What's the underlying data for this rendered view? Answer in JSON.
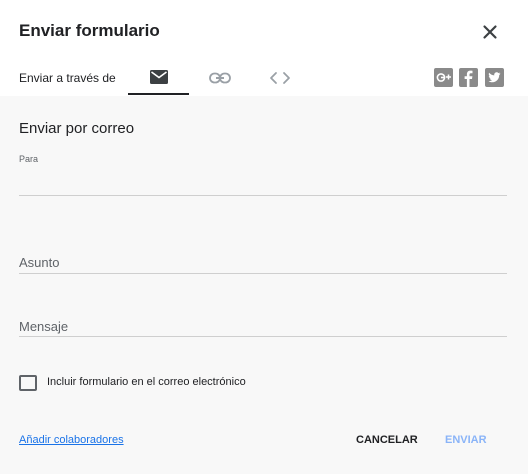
{
  "dialog": {
    "title": "Enviar formulario",
    "close_icon": "close-icon"
  },
  "send_via": {
    "label": "Enviar a través de",
    "tabs": [
      {
        "name": "email",
        "icon": "mail-icon",
        "active": true
      },
      {
        "name": "link",
        "icon": "link-icon",
        "active": false
      },
      {
        "name": "embed",
        "icon": "code-icon",
        "active": false
      }
    ],
    "social": [
      {
        "name": "google-plus",
        "icon": "google-plus-icon"
      },
      {
        "name": "facebook",
        "icon": "facebook-icon"
      },
      {
        "name": "twitter",
        "icon": "twitter-icon"
      }
    ]
  },
  "email_form": {
    "section_title": "Enviar por correo",
    "to_label": "Para",
    "to_value": "",
    "subject_placeholder": "Asunto",
    "message_placeholder": "Mensaje",
    "include_form_label": "Incluir formulario en el correo electrónico",
    "include_form_checked": false
  },
  "footer": {
    "add_collaborators": "Añadir colaboradores",
    "cancel_label": "CANCELAR",
    "send_label": "ENVIAR"
  },
  "colors": {
    "link": "#1a73e8",
    "send_disabled": "#8ab4f8",
    "body_background": "#f8f8f8",
    "social_gray": "#8a8a8a"
  }
}
